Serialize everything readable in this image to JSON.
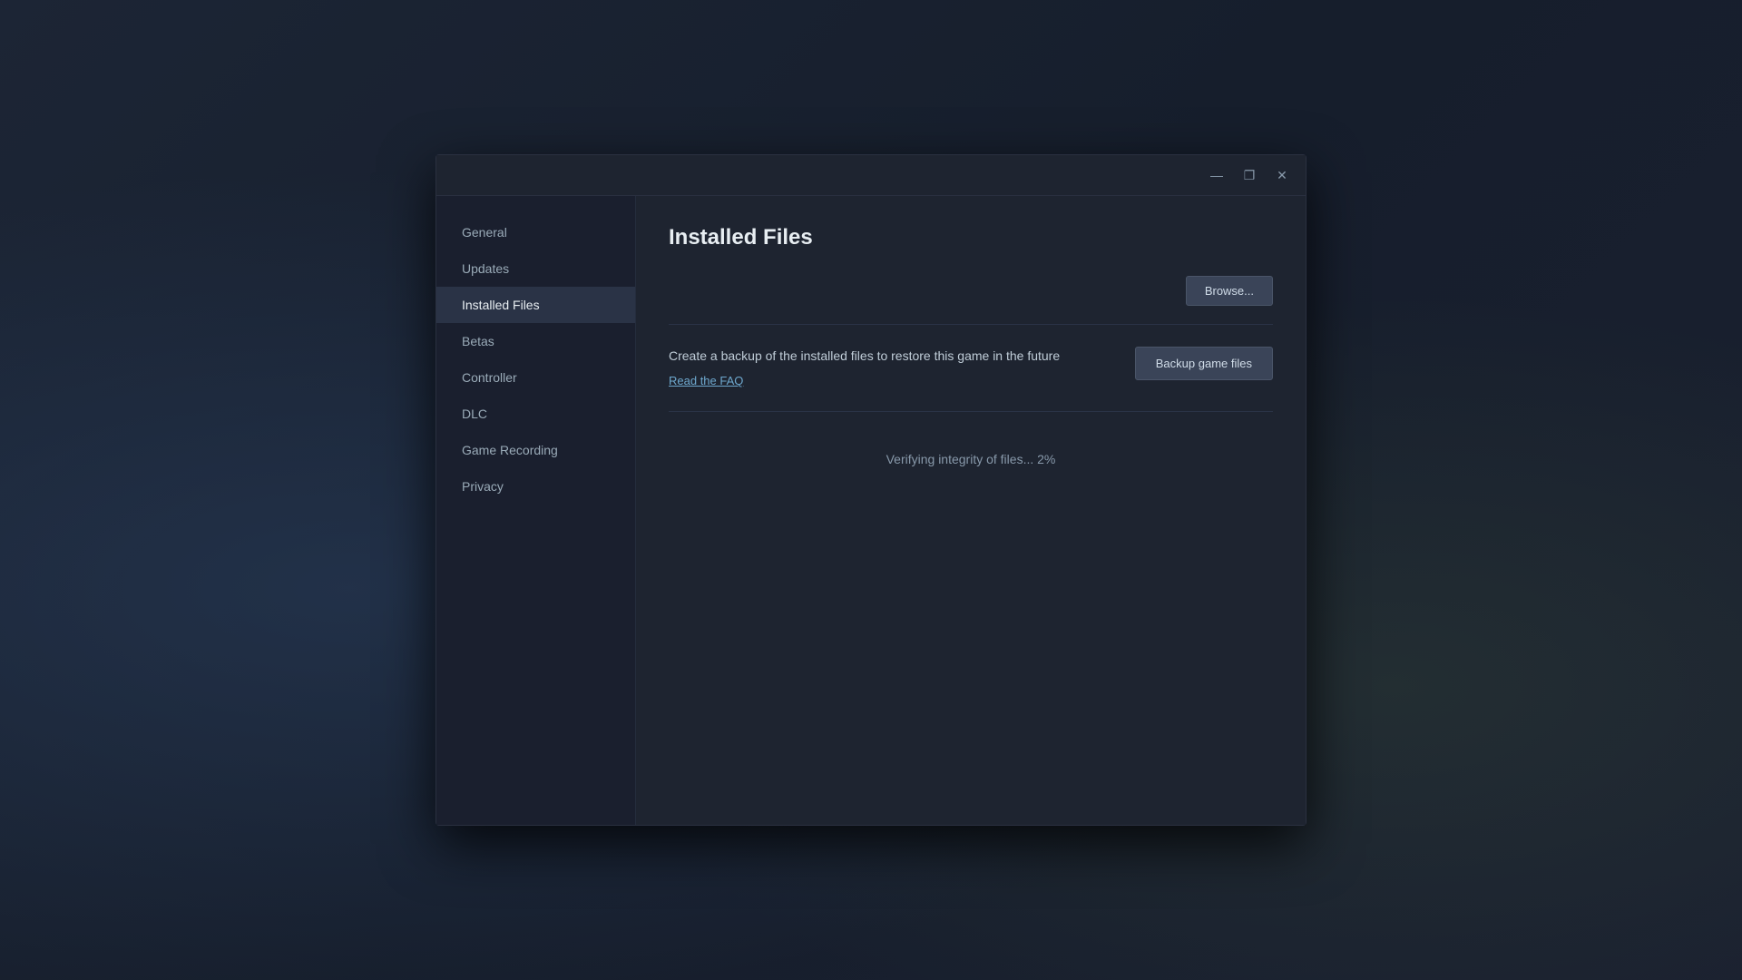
{
  "window": {
    "titlebar": {
      "minimize": "—",
      "maximize": "❐",
      "close": "✕"
    }
  },
  "sidebar": {
    "items": [
      {
        "id": "general",
        "label": "General",
        "active": false
      },
      {
        "id": "updates",
        "label": "Updates",
        "active": false
      },
      {
        "id": "installed-files",
        "label": "Installed Files",
        "active": true
      },
      {
        "id": "betas",
        "label": "Betas",
        "active": false
      },
      {
        "id": "controller",
        "label": "Controller",
        "active": false
      },
      {
        "id": "dlc",
        "label": "DLC",
        "active": false
      },
      {
        "id": "game-recording",
        "label": "Game Recording",
        "active": false
      },
      {
        "id": "privacy",
        "label": "Privacy",
        "active": false
      }
    ]
  },
  "main": {
    "title": "Installed Files",
    "browse_button": "Browse...",
    "backup": {
      "description": "Create a backup of the installed files to restore this game in the future",
      "faq_link": "Read the FAQ",
      "button": "Backup game files"
    },
    "verify_status": "Verifying integrity of files... 2%"
  }
}
